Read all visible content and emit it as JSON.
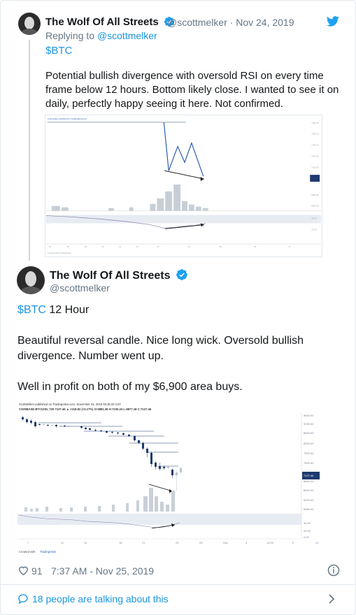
{
  "parent_tweet": {
    "author_name": "The Wolf Of All Streets",
    "meta": "@scottmelker · Nov 24, 2019",
    "replying_prefix": "Replying to ",
    "replying_handle": "@scottmelker",
    "cashtag": "$BTC",
    "text": "Potential bullish divergence with oversold RSI on every time frame below 12 hours. Bottom likely close. I wanted to see it on daily, perfectly happy seeing it here. Not confirmed."
  },
  "main_tweet": {
    "author_name": "The Wolf Of All Streets",
    "handle": "@scottmelker",
    "cashtag": "$BTC",
    "line1_rest": " 12 Hour",
    "line2": "Beautiful reversal candle. Nice long wick. Oversold bullish divergence. Number went up.",
    "line3": "Well in profit on both of my $6,900 area buys.",
    "likes": "91",
    "timestamp": "7:37 AM - Nov 25, 2019"
  },
  "conversation": {
    "label": "18 people are talking about this"
  },
  "main_chart_text": {
    "header1": "ScottMelker published on TradingView.com, November 23, 2019 06:36:33 CST",
    "header2": "COINBASE:BTCUSD, 720  7127.46  ▲  +218.82 (+3.17%)  O:6881.39  H:7230.24  L:6877.18  C:7127.46",
    "created_with": "Created with",
    "tradingview": "TradingView",
    "price_ticks": [
      "9600.00",
      "9200.00",
      "8800.00",
      "8300.00",
      "7900.00",
      "7500.00",
      "7127.46",
      "6800.00",
      "6500.00",
      "6200.00",
      "5960.00"
    ],
    "rsi_ticks": [
      "40.00",
      "20.00",
      "0.00"
    ],
    "x_ticks": [
      "7",
      "11",
      "14",
      "18",
      "21",
      "23",
      "25",
      "Dec",
      "4",
      "10:00",
      "9",
      "12"
    ]
  },
  "colors": {
    "accent": "#1b95e0",
    "secondary_text": "#657786",
    "candle_up": "#b9c2cc",
    "candle_down": "#1e3a6e",
    "rsi_band": "#e7ecf3"
  }
}
